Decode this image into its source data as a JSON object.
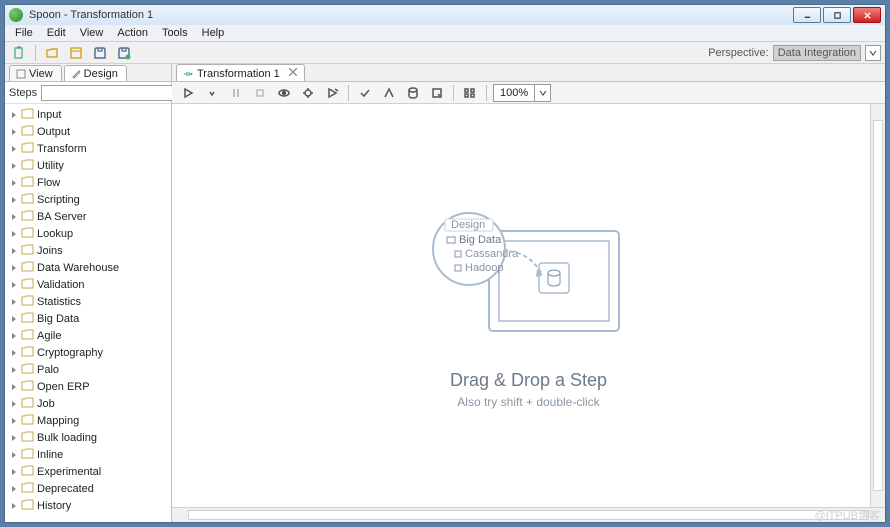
{
  "window": {
    "title": "Spoon - Transformation 1"
  },
  "menu": [
    "File",
    "Edit",
    "View",
    "Action",
    "Tools",
    "Help"
  ],
  "perspective": {
    "label": "Perspective:",
    "value": "Data Integration"
  },
  "sidebar": {
    "tabs": [
      {
        "label": "View"
      },
      {
        "label": "Design"
      }
    ],
    "active_tab": 1,
    "steps_label": "Steps",
    "search": "",
    "categories": [
      "Input",
      "Output",
      "Transform",
      "Utility",
      "Flow",
      "Scripting",
      "BA Server",
      "Lookup",
      "Joins",
      "Data Warehouse",
      "Validation",
      "Statistics",
      "Big Data",
      "Agile",
      "Cryptography",
      "Palo",
      "Open ERP",
      "Job",
      "Mapping",
      "Bulk loading",
      "Inline",
      "Experimental",
      "Deprecated",
      "History"
    ]
  },
  "editor": {
    "tab_label": "Transformation 1",
    "zoom": "100%",
    "placeholder_tab": "Design",
    "placeholder_items": [
      "Big Data",
      "Cassandra",
      "Hadoop"
    ],
    "drag_text": "Drag & Drop a Step",
    "sub_text": "Also try shift + double-click"
  },
  "watermark": "@ITPUB博客"
}
